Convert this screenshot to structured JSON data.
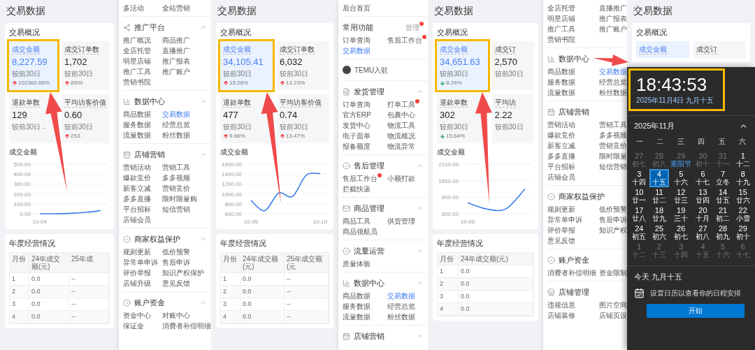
{
  "panels": [
    {
      "kind": "dashboard",
      "title": "交易数据",
      "overview": {
        "title": "交易概况",
        "metrics": [
          {
            "label": "成交金额",
            "value": "8,227.59",
            "compare": "较前30日",
            "up": true,
            "delta": "102360.65%",
            "selected": true,
            "highlighted": true
          },
          {
            "label": "成交订单数",
            "value": "1,702",
            "compare": "较前30日",
            "up": true,
            "delta": "8500",
            "selected": false,
            "highlighted": false
          },
          {
            "label": "退款单数",
            "value": "129",
            "compare": "较前30日",
            "delta": "--",
            "selected": false,
            "highlighted": false
          },
          {
            "label": "平均访客价值",
            "value": "0.60",
            "compare": "较前30日",
            "up": true,
            "delta": "253.",
            "selected": false,
            "highlighted": false
          }
        ]
      },
      "chart_data": {
        "type": "line",
        "title": "成交金额",
        "categories": [
          "10-04",
          null,
          null,
          null,
          null
        ],
        "grid": true,
        "ylim": [
          0,
          500
        ],
        "yticks": [
          {
            "value": 0,
            "label": "0.00"
          },
          {
            "value": 100,
            "label": "100.00"
          },
          {
            "value": 200,
            "label": "200.00"
          },
          {
            "value": 300,
            "label": "300.00"
          },
          {
            "value": 400,
            "label": "400.00"
          },
          {
            "value": 500,
            "label": "500.00"
          }
        ],
        "series": [
          {
            "color": "#3b7ded",
            "values": [
              0,
              0,
              4,
              14,
              32
            ]
          }
        ]
      },
      "annual": {
        "title": "年度经营情况",
        "columns": [
          "月份",
          "24年成交额(元)",
          "25年成"
        ],
        "rows": [
          [
            "1",
            "0.0",
            "--"
          ],
          [
            "2",
            "0.0",
            "--"
          ],
          [
            "3",
            "0.0",
            "--"
          ],
          [
            "4",
            "0.0",
            "--"
          ]
        ]
      }
    },
    {
      "kind": "menu",
      "blocks": [
        {
          "kind": "items",
          "items": [
            {
              "label": "多活动",
              "selected": false
            },
            {
              "label": "全站营销",
              "selected": false
            }
          ]
        },
        {
          "kind": "section",
          "title": "推广平台",
          "expanded": true,
          "items": [
            {
              "label": "推广概况",
              "selected": false
            },
            {
              "label": "商品推广",
              "selected": false
            },
            {
              "label": "全店托管",
              "selected": false
            },
            {
              "label": "直播推广",
              "selected": false
            },
            {
              "label": "明星店铺",
              "selected": false
            },
            {
              "label": "推广报表",
              "selected": false
            },
            {
              "label": "推广工具",
              "selected": false
            },
            {
              "label": "推广账户",
              "selected": false
            },
            {
              "label": "营销书院",
              "selected": false
            }
          ]
        },
        {
          "kind": "section",
          "title": "数据中心",
          "expanded": true,
          "items": [
            {
              "label": "商品数据",
              "selected": false
            },
            {
              "label": "交易数据",
              "selected": true
            },
            {
              "label": "服务数据",
              "selected": false
            },
            {
              "label": "经营总览",
              "selected": false
            },
            {
              "label": "流量数据",
              "selected": false
            },
            {
              "label": "粉丝数据",
              "selected": false
            }
          ]
        },
        {
          "kind": "section",
          "title": "店铺营销",
          "expanded": true,
          "items": [
            {
              "label": "营销活动",
              "selected": false
            },
            {
              "label": "营销工具",
              "selected": false
            },
            {
              "label": "爆款竞价",
              "selected": false
            },
            {
              "label": "多多视频",
              "selected": false
            },
            {
              "label": "新客立减",
              "selected": false
            },
            {
              "label": "营销竞价",
              "selected": false
            },
            {
              "label": "多多直播",
              "selected": false
            },
            {
              "label": "限时限量购",
              "selected": false
            },
            {
              "label": "平台招标",
              "selected": false
            },
            {
              "label": "短信营销",
              "selected": false
            },
            {
              "label": "店铺会员",
              "selected": false
            }
          ]
        },
        {
          "kind": "section",
          "title": "商家权益保护",
          "expanded": true,
          "items": [
            {
              "label": "规则更新",
              "selected": false
            },
            {
              "label": "低价预警",
              "selected": false
            },
            {
              "label": "异常单申诉",
              "selected": false
            },
            {
              "label": "售后申诉",
              "selected": false
            },
            {
              "label": "评价举报",
              "selected": false
            },
            {
              "label": "知识产权保护",
              "selected": false
            },
            {
              "label": "店铺升级",
              "selected": false
            },
            {
              "label": "意见反馈",
              "selected": false
            }
          ]
        },
        {
          "kind": "section",
          "title": "账户资金",
          "expanded": true,
          "items": [
            {
              "label": "资金中心",
              "selected": false
            },
            {
              "label": "对账中心",
              "selected": false
            },
            {
              "label": "保证金",
              "selected": false
            },
            {
              "label": "消费者补偿明细",
              "selected": false
            }
          ]
        }
      ]
    },
    {
      "kind": "dashboard",
      "title": "交易数据",
      "overview": {
        "title": "交易概况",
        "metrics": [
          {
            "label": "成交金额",
            "value": "34,105.41",
            "compare": "较前30日",
            "up": true,
            "delta": "15.28%",
            "selected": true,
            "highlighted": true
          },
          {
            "label": "成交订单数",
            "value": "6,032",
            "compare": "较前30日",
            "up": true,
            "delta": "13.23%",
            "selected": false,
            "highlighted": false
          },
          {
            "label": "退款单数",
            "value": "477",
            "compare": "较前30日",
            "up": true,
            "delta": "9.66%",
            "selected": false,
            "highlighted": false
          },
          {
            "label": "平均访客价值",
            "value": "0.74",
            "compare": "较前30日",
            "up": true,
            "delta": "13.47%",
            "selected": false,
            "highlighted": false
          }
        ]
      },
      "chart_data": {
        "type": "line",
        "title": "成交金额",
        "categories": [
          "10-05",
          null,
          null,
          null,
          null,
          "10-10"
        ],
        "grid": true,
        "ylim": [
          600,
          1600
        ],
        "yticks": [
          {
            "value": 600,
            "label": "600.00"
          },
          {
            "value": 800,
            "label": "800.00"
          },
          {
            "value": 1000,
            "label": "1000.00"
          },
          {
            "value": 1200,
            "label": "1200.00"
          },
          {
            "value": 1400,
            "label": "1400.00"
          },
          {
            "value": 1600,
            "label": "1600.00"
          }
        ],
        "series": [
          {
            "color": "#3b7ded",
            "values": [
              870,
              660,
              1020,
              950,
              1380,
              1410
            ]
          }
        ]
      },
      "annual": {
        "title": "年度经营情况",
        "columns": [
          "月份",
          "24年成交额(元)",
          "25年成交额(元"
        ],
        "rows": [
          [
            "1",
            "0.0",
            "--"
          ],
          [
            "2",
            "0.0",
            "--"
          ],
          [
            "3",
            "0.0",
            "--"
          ],
          [
            "4",
            "0.0",
            "--"
          ]
        ]
      }
    },
    {
      "kind": "menu",
      "blocks": [
        {
          "kind": "items",
          "items": [
            {
              "label": "后台首页",
              "selected": false,
              "badge": false
            }
          ]
        },
        {
          "kind": "quick",
          "title": "常用功能",
          "action": "管理",
          "action_badge": true,
          "items": [
            {
              "label": "订单查询",
              "selected": false,
              "badge": false
            },
            {
              "label": "售后工作台",
              "selected": false,
              "badge": true
            },
            {
              "label": "交易数据",
              "selected": true,
              "badge": false
            }
          ]
        },
        {
          "kind": "entry",
          "label": "TEMU入驻"
        },
        {
          "kind": "section",
          "title": "发货管理",
          "expanded": true,
          "items": [
            {
              "label": "订单查询",
              "selected": false,
              "badge": false
            },
            {
              "label": "打单工具",
              "selected": false,
              "badge": true
            },
            {
              "label": "官方ERP",
              "selected": false,
              "badge": false
            },
            {
              "label": "包裹中心",
              "selected": false,
              "badge": false
            },
            {
              "label": "发货中心",
              "selected": false,
              "badge": false
            },
            {
              "label": "物流工具",
              "selected": false,
              "badge": false
            },
            {
              "label": "电子面单",
              "selected": false,
              "badge": false
            },
            {
              "label": "物流概况",
              "selected": false,
              "badge": false
            },
            {
              "label": "报备额度",
              "selected": false,
              "badge": false
            },
            {
              "label": "物流异常",
              "selected": false,
              "badge": false
            }
          ]
        },
        {
          "kind": "section",
          "title": "售后管理",
          "expanded": true,
          "items": [
            {
              "label": "售后工作台",
              "selected": false,
              "badge": true
            },
            {
              "label": "小额打款",
              "selected": false,
              "badge": false
            },
            {
              "label": "拦截快递",
              "selected": false,
              "badge": false
            }
          ]
        },
        {
          "kind": "section",
          "title": "商品管理",
          "expanded": true,
          "items": [
            {
              "label": "商品工具",
              "selected": false,
              "badge": false
            },
            {
              "label": "供货管理",
              "selected": false,
              "badge": false
            },
            {
              "label": "商品领航员",
              "selected": false,
              "badge": false
            }
          ]
        },
        {
          "kind": "section",
          "title": "流量运营",
          "expanded": true,
          "items": [
            {
              "label": "质量体验",
              "selected": false,
              "badge": false
            }
          ]
        },
        {
          "kind": "section",
          "title": "数据中心",
          "expanded": true,
          "items": [
            {
              "label": "商品数据",
              "selected": false,
              "badge": false
            },
            {
              "label": "交易数据",
              "selected": true,
              "badge": false
            },
            {
              "label": "服务数据",
              "selected": false,
              "badge": false
            },
            {
              "label": "经营总览",
              "selected": false,
              "badge": false
            },
            {
              "label": "流量数据",
              "selected": false,
              "badge": false
            },
            {
              "label": "粉丝数据",
              "selected": false,
              "badge": false
            }
          ]
        },
        {
          "kind": "section",
          "title": "店铺营销",
          "expanded": true
        }
      ]
    },
    {
      "kind": "dashboard",
      "title": "交易数据",
      "overview": {
        "title": "交易概况",
        "metrics": [
          {
            "label": "成交金额",
            "value": "34,651.63",
            "compare": "较前30日",
            "up": false,
            "delta": "8.24%",
            "selected": true,
            "highlighted": true
          },
          {
            "label": "成交订",
            "value": "2,570",
            "compare": "较前30日",
            "selected": false,
            "highlighted": false
          },
          {
            "label": "退款单数",
            "value": "302",
            "compare": "较前30日",
            "up": false,
            "delta": "15.64%",
            "selected": false,
            "highlighted": false
          },
          {
            "label": "平均访",
            "value": "2.22",
            "compare": "较前30日",
            "selected": false,
            "highlighted": false
          }
        ]
      },
      "chart_data": {
        "type": "line",
        "title": "成交金额",
        "categories": [
          "10-05",
          null,
          null,
          null
        ],
        "grid": true,
        "ylim": [
          300,
          2100
        ],
        "yticks": [
          {
            "value": 300,
            "label": "300.00"
          },
          {
            "value": 900,
            "label": "900.00"
          },
          {
            "value": 1500,
            "label": "1500.00"
          },
          {
            "value": 2100,
            "label": "2100.00"
          }
        ],
        "series": [
          {
            "color": "#3b7ded",
            "values": [
              700,
              470,
              480,
              1200
            ]
          }
        ]
      },
      "annual": {
        "title": "年度经营情况",
        "columns": [
          "月份",
          "24年成交额(元)"
        ],
        "rows": [
          [
            "1",
            "0.0"
          ],
          [
            "2",
            "0.0"
          ],
          [
            "3",
            "0.0"
          ],
          [
            "4",
            "0.0"
          ]
        ]
      }
    },
    {
      "kind": "menu",
      "blocks": [
        {
          "kind": "items",
          "items": [
            {
              "label": "全店托管",
              "selected": false
            },
            {
              "label": "直播推广",
              "selected": false
            },
            {
              "label": "明星店铺",
              "selected": false
            },
            {
              "label": "推广报表",
              "selected": false
            },
            {
              "label": "推广工具",
              "selected": false
            },
            {
              "label": "推广账户",
              "selected": false
            },
            {
              "label": "营销书院",
              "selected": false
            }
          ]
        },
        {
          "kind": "section",
          "title": "数据中心",
          "items": [
            {
              "label": "商品数据",
              "selected": false
            },
            {
              "label": "交易数据",
              "selected": true
            },
            {
              "label": "服务数据",
              "selected": false
            },
            {
              "label": "经营总览",
              "selected": false
            },
            {
              "label": "流量数据",
              "selected": false
            },
            {
              "label": "粉丝数据",
              "selected": false
            }
          ]
        },
        {
          "kind": "section",
          "title": "店铺营销",
          "items": [
            {
              "label": "营销活动",
              "selected": false
            },
            {
              "label": "营销工具",
              "selected": false
            },
            {
              "label": "爆款竞价",
              "selected": false
            },
            {
              "label": "多多视频",
              "selected": false
            },
            {
              "label": "新客立减",
              "selected": false
            },
            {
              "label": "营销竞价",
              "selected": false
            },
            {
              "label": "多多直播",
              "selected": false
            },
            {
              "label": "限时限量",
              "selected": false
            },
            {
              "label": "平台招标",
              "selected": false
            },
            {
              "label": "短信营销",
              "selected": false
            },
            {
              "label": "店铺会员",
              "selected": false
            }
          ]
        },
        {
          "kind": "section",
          "title": "商家权益保护",
          "items": [
            {
              "label": "规则更新",
              "selected": false
            },
            {
              "label": "低价预警",
              "selected": false
            },
            {
              "label": "异常单申诉",
              "selected": false
            },
            {
              "label": "售后申诉",
              "selected": false
            },
            {
              "label": "评价举报",
              "selected": false
            },
            {
              "label": "知识产权",
              "selected": false
            },
            {
              "label": "意见反馈",
              "selected": false
            }
          ]
        },
        {
          "kind": "section",
          "title": "账户资金",
          "items": [
            {
              "label": "消费者补偿明细",
              "selected": false
            },
            {
              "label": "资金限制",
              "selected": false
            }
          ]
        },
        {
          "kind": "section",
          "title": "店铺管理",
          "items": [
            {
              "label": "违规信息",
              "selected": false
            },
            {
              "label": "图片空间",
              "selected": false
            },
            {
              "label": "店铺装修",
              "selected": false
            },
            {
              "label": "店铺页设",
              "selected": false
            }
          ]
        }
      ]
    },
    {
      "kind": "dashboard",
      "title": "交易数据",
      "overview": {
        "title": "交易概况",
        "metrics": [
          {
            "label": "成交金额",
            "selected": true,
            "highlighted": false
          },
          {
            "label": "成交订",
            "selected": false,
            "highlighted": false
          }
        ]
      }
    }
  ],
  "calendar": {
    "highlighted": true,
    "time": "18:43:53",
    "date": "2025年11月4日 九月十五",
    "month": "2025年11月",
    "weekdays": [
      "一",
      "二",
      "三",
      "四",
      "五",
      "六"
    ],
    "weeks": [
      [
        {
          "day": "27",
          "lunar": "初七",
          "in_month": false,
          "selected": false,
          "festival": false
        },
        {
          "day": "28",
          "lunar": "初八",
          "in_month": false,
          "selected": false,
          "festival": false
        },
        {
          "day": "29",
          "lunar": "重阳节",
          "in_month": false,
          "selected": false,
          "festival": true
        },
        {
          "day": "30",
          "lunar": "初十",
          "in_month": false,
          "selected": false,
          "festival": false
        },
        {
          "day": "31",
          "lunar": "十一",
          "in_month": false,
          "selected": false,
          "festival": false
        },
        {
          "day": "1",
          "lunar": "十二",
          "in_month": true,
          "selected": false,
          "festival": false
        }
      ],
      [
        {
          "day": "3",
          "lunar": "十四",
          "in_month": true,
          "selected": false,
          "festival": false
        },
        {
          "day": "4",
          "lunar": "十五",
          "in_month": true,
          "selected": true,
          "festival": false
        },
        {
          "day": "5",
          "lunar": "十六",
          "in_month": true,
          "selected": false,
          "festival": false
        },
        {
          "day": "6",
          "lunar": "十七",
          "in_month": true,
          "selected": false,
          "festival": false
        },
        {
          "day": "7",
          "lunar": "立冬",
          "in_month": true,
          "selected": false,
          "festival": false
        },
        {
          "day": "8",
          "lunar": "十九",
          "in_month": true,
          "selected": false,
          "festival": false
        }
      ],
      [
        {
          "day": "10",
          "lunar": "廿一",
          "in_month": true,
          "selected": false,
          "festival": false
        },
        {
          "day": "11",
          "lunar": "廿二",
          "in_month": true,
          "selected": false,
          "festival": false
        },
        {
          "day": "12",
          "lunar": "廿三",
          "in_month": true,
          "selected": false,
          "festival": false
        },
        {
          "day": "13",
          "lunar": "廿四",
          "in_month": true,
          "selected": false,
          "festival": false
        },
        {
          "day": "14",
          "lunar": "廿五",
          "in_month": true,
          "selected": false,
          "festival": false
        },
        {
          "day": "15",
          "lunar": "廿六",
          "in_month": true,
          "selected": false,
          "festival": false
        }
      ],
      [
        {
          "day": "17",
          "lunar": "廿八",
          "in_month": true,
          "selected": false,
          "festival": false
        },
        {
          "day": "18",
          "lunar": "廿九",
          "in_month": true,
          "selected": false,
          "festival": false
        },
        {
          "day": "19",
          "lunar": "三十",
          "in_month": true,
          "selected": false,
          "festival": false
        },
        {
          "day": "20",
          "lunar": "十月",
          "in_month": true,
          "selected": false,
          "festival": false
        },
        {
          "day": "21",
          "lunar": "初二",
          "in_month": true,
          "selected": false,
          "festival": false
        },
        {
          "day": "22",
          "lunar": "小雪",
          "in_month": true,
          "selected": false,
          "festival": false
        }
      ],
      [
        {
          "day": "24",
          "lunar": "初五",
          "in_month": true,
          "selected": false,
          "festival": false
        },
        {
          "day": "25",
          "lunar": "初六",
          "in_month": true,
          "selected": false,
          "festival": false
        },
        {
          "day": "26",
          "lunar": "初七",
          "in_month": true,
          "selected": false,
          "festival": false
        },
        {
          "day": "27",
          "lunar": "初八",
          "in_month": true,
          "selected": false,
          "festival": false
        },
        {
          "day": "28",
          "lunar": "初九",
          "in_month": true,
          "selected": false,
          "festival": false
        },
        {
          "day": "29",
          "lunar": "初十",
          "in_month": true,
          "selected": false,
          "festival": false
        }
      ],
      [
        {
          "day": "1",
          "lunar": "十二",
          "in_month": false,
          "selected": false,
          "festival": false
        },
        {
          "day": "2",
          "lunar": "十三",
          "in_month": false,
          "selected": false,
          "festival": false
        },
        {
          "day": "3",
          "lunar": "十四",
          "in_month": false,
          "selected": false,
          "festival": false
        },
        {
          "day": "4",
          "lunar": "十五",
          "in_month": false,
          "selected": false,
          "festival": false
        },
        {
          "day": "5",
          "lunar": "十六",
          "in_month": false,
          "selected": false,
          "festival": false
        },
        {
          "day": "6",
          "lunar": "十七",
          "in_month": false,
          "selected": false,
          "festival": false
        }
      ]
    ],
    "today": "今天 九月十五",
    "agenda_hint": "设置日历以查看你的日程安排",
    "button": "开始"
  }
}
